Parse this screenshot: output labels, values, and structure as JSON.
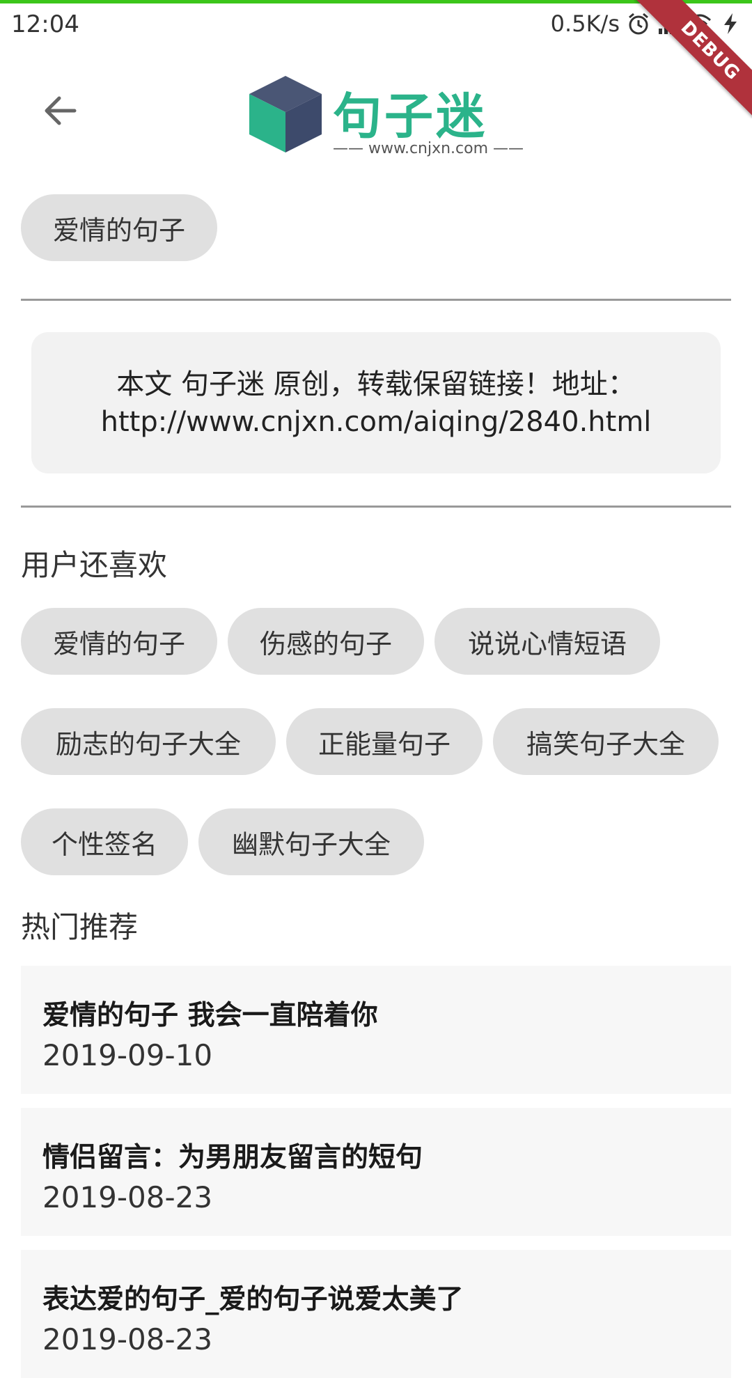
{
  "status_bar": {
    "time": "12:04",
    "network_speed": "0.5K/s",
    "icons": [
      "alarm-icon",
      "signal-icon",
      "wifi-icon",
      "charging-icon"
    ]
  },
  "debug_banner": "DEBUG",
  "app_bar": {
    "back_icon": "arrow-back-icon",
    "logo_title": "句子迷",
    "logo_url": "—— www.cnjxn.com ——"
  },
  "category_chip": "爱情的句子",
  "notice": {
    "line1": "本文 句子迷 原创，转载保留链接！地址：",
    "line2": "http://www.cnjxn.com/aiqing/2840.html"
  },
  "also_like": {
    "title": "用户还喜欢",
    "tags": [
      "爱情的句子",
      "伤感的句子",
      "说说心情短语",
      "励志的句子大全",
      "正能量句子",
      "搞笑句子大全",
      "个性签名",
      "幽默句子大全"
    ]
  },
  "hot": {
    "title": "热门推荐",
    "items": [
      {
        "title": "爱情的句子 我会一直陪着你",
        "date": "2019-09-10"
      },
      {
        "title": "情侣留言：为男朋友留言的短句",
        "date": "2019-08-23"
      },
      {
        "title": "表达爱的句子_爱的句子说爱太美了",
        "date": "2019-08-23"
      }
    ]
  },
  "colors": {
    "status_line": "#3cc61a",
    "logo_green": "#2bb38a",
    "logo_cube_dark": "#3d4a6b",
    "chip_bg": "#e0e0e0",
    "debug_red": "#b0323c"
  }
}
